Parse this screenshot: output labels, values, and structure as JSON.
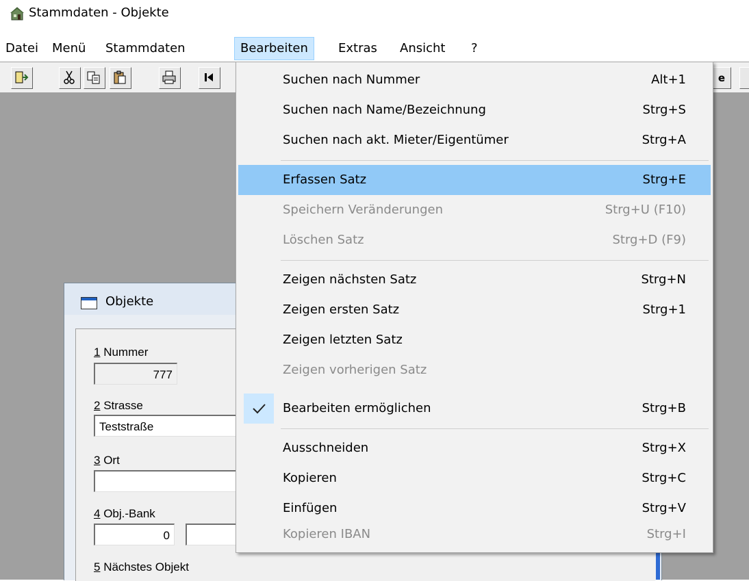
{
  "window": {
    "title": "Stammdaten - Objekte"
  },
  "menubar": {
    "items": [
      {
        "label": "Datei"
      },
      {
        "label": "Menü"
      },
      {
        "label": "Stammdaten"
      },
      {
        "label": "Bearbeiten"
      },
      {
        "label": "Extras"
      },
      {
        "label": "Ansicht"
      },
      {
        "label": "?"
      }
    ]
  },
  "toolbar": {
    "icons": [
      "exit-icon",
      "cut-icon",
      "copy-icon",
      "paste-icon",
      "print-icon",
      "first-record-icon"
    ],
    "partial_right": [
      "e"
    ]
  },
  "dropdown": {
    "items": [
      {
        "label": "Suchen nach Nummer",
        "shortcut": "Alt+1",
        "state": "normal"
      },
      {
        "label": "Suchen nach Name/Bezeichnung",
        "shortcut": "Strg+S",
        "state": "normal"
      },
      {
        "label": "Suchen nach akt. Mieter/Eigentümer",
        "shortcut": "Strg+A",
        "state": "normal"
      },
      {
        "label": "Erfassen Satz",
        "shortcut": "Strg+E",
        "state": "highlighted"
      },
      {
        "label": "Speichern Veränderungen",
        "shortcut": "Strg+U (F10)",
        "state": "disabled"
      },
      {
        "label": "Löschen Satz",
        "shortcut": "Strg+D (F9)",
        "state": "disabled"
      },
      {
        "label": "Zeigen nächsten Satz",
        "shortcut": "Strg+N",
        "state": "normal"
      },
      {
        "label": "Zeigen ersten Satz",
        "shortcut": "Strg+1",
        "state": "normal"
      },
      {
        "label": "Zeigen letzten Satz",
        "shortcut": "",
        "state": "normal"
      },
      {
        "label": "Zeigen vorherigen Satz",
        "shortcut": "",
        "state": "disabled"
      },
      {
        "label": "Bearbeiten ermöglichen",
        "shortcut": "Strg+B",
        "state": "checked"
      },
      {
        "label": "Ausschneiden",
        "shortcut": "Strg+X",
        "state": "normal"
      },
      {
        "label": "Kopieren",
        "shortcut": "Strg+C",
        "state": "normal"
      },
      {
        "label": "Einfügen",
        "shortcut": "Strg+V",
        "state": "normal"
      },
      {
        "label": "Kopieren IBAN",
        "shortcut": "Strg+I",
        "state": "disabled"
      }
    ]
  },
  "child_window": {
    "title": "Objekte",
    "fields": [
      {
        "num": "1",
        "label": " Nummer",
        "value": "777"
      },
      {
        "num": "2",
        "label": " Strasse",
        "value": "Teststraße"
      },
      {
        "num": "3",
        "label": " Ort",
        "value": ""
      },
      {
        "num": "4",
        "label": " Obj.-Bank",
        "value": "0",
        "value2": ""
      },
      {
        "num": "5",
        "label": " Nächstes Objekt"
      }
    ]
  },
  "colors": {
    "highlight": "#91c9f7",
    "menu_active": "#cce8ff",
    "workspace": "#a0a0a0"
  }
}
